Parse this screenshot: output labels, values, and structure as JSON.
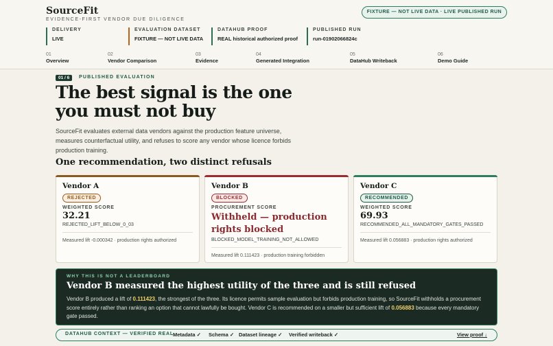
{
  "brand": {
    "name": "SourceFit",
    "tagline": "EVIDENCE-FIRST VENDOR DUE DILIGENCE"
  },
  "fixture_badge": "FIXTURE — NOT LIVE DATA · LIVE PUBLISHED RUN",
  "meta": [
    {
      "label": "DELIVERY",
      "value": "LIVE",
      "accent": "#2e6b57"
    },
    {
      "label": "EVALUATION DATASET",
      "value": "FIXTURE — NOT LIVE DATA",
      "accent": "#b5651d"
    },
    {
      "label": "DATAHUB PROOF",
      "value": "REAL historical authorized proof",
      "accent": "#2e6b57"
    },
    {
      "label": "PUBLISHED RUN",
      "value": "run-01902066824c",
      "accent": "#2e6b57"
    }
  ],
  "nav": [
    {
      "num": "01",
      "label": "Overview"
    },
    {
      "num": "02",
      "label": "Vendor Comparison"
    },
    {
      "num": "03",
      "label": "Evidence"
    },
    {
      "num": "04",
      "label": "Generated Integration"
    },
    {
      "num": "05",
      "label": "DataHub Writeback"
    },
    {
      "num": "06",
      "label": "Demo Guide"
    }
  ],
  "hero": {
    "step": "01 / 6",
    "eyebrow": "PUBLISHED EVALUATION",
    "headline": "The best signal is the one you must not buy",
    "lede": "SourceFit evaluates external data vendors against the production feature universe, measures counterfactual utility, and refuses to score any vendor whose licence forbids production training.",
    "section_title": "One recommendation, two distinct refusals"
  },
  "vendors": [
    {
      "name": "Vendor A",
      "status": "REJECTED",
      "score_label": "WEIGHTED SCORE",
      "score": "32.21",
      "code": "REJECTED_LIFT_BELOW_0_03",
      "note": "Measured lift -0.000342 · production rights authorized",
      "accent": "#8a5a1e",
      "pill_color": "#9a5b1c",
      "pill_bg": "#fbefe1"
    },
    {
      "name": "Vendor B",
      "status": "BLOCKED",
      "score_label": "PROCUREMENT SCORE",
      "score": "Withheld — production rights blocked",
      "code": "BLOCKED_MODEL_TRAINING_NOT_ALLOWED",
      "note": "Measured lift 0.111423 · production training forbidden",
      "accent": "#9c2b30",
      "pill_color": "#9c2b30",
      "pill_bg": "#fbe9e8"
    },
    {
      "name": "Vendor C",
      "status": "RECOMMENDED",
      "score_label": "WEIGHTED SCORE",
      "score": "69.93",
      "code": "RECOMMENDED_ALL_MANDATORY_GATES_PASSED",
      "note": "Measured lift 0.056883 · production rights authorized",
      "accent": "#2e7d61",
      "pill_color": "#1e5a45",
      "pill_bg": "#e6f2ec"
    }
  ],
  "callout": {
    "eyebrow": "WHY THIS IS NOT A LEADERBOARD",
    "title": "Vendor B measured the highest utility of the three and is still refused",
    "body_1": "Vendor B produced a lift of ",
    "hl_1": "0.111423",
    "body_2": ", the strongest of the three. Its licence permits sample evaluation but forbids production training, so SourceFit withholds a procurement score entirely rather than ranking an option that cannot lawfully be bought. Vendor C is recommended on a smaller but sufficient lift of ",
    "hl_2": "0.056883",
    "body_3": " because every mandatory gate passed."
  },
  "footer": {
    "eyebrow": "DATAHUB CONTEXT — VERIFIED REAL",
    "checks": [
      "Metadata ✓",
      "Schema ✓",
      "Dataset lineage ✓",
      "Verified writeback ✓"
    ],
    "proof_link": "View proof ↓"
  }
}
